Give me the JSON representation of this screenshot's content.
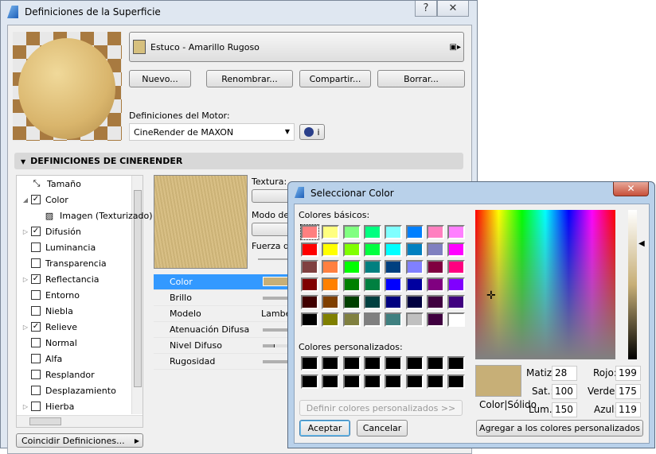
{
  "main": {
    "title": "Definiciones de la Superficie",
    "help": "?",
    "close": "✕",
    "material_name": "Estuco - Amarillo Rugoso",
    "material_color": "#d6c07e",
    "buttons": [
      "Nuevo...",
      "Renombrar...",
      "Compartir...",
      "Borrar..."
    ],
    "engine_label": "Definiciones del Motor:",
    "engine_value": "CineRender de MAXON",
    "info": "i",
    "section": "DEFINICIONES DE CINERENDER",
    "tree": [
      {
        "label": "Tamaño",
        "type": "icon"
      },
      {
        "label": "Color",
        "checked": true,
        "expanded": true
      },
      {
        "label": "Imagen (Texturizado)",
        "type": "image"
      },
      {
        "label": "Difusión",
        "checked": true,
        "expandable": true
      },
      {
        "label": "Luminancia",
        "checked": false
      },
      {
        "label": "Transparencia",
        "checked": false
      },
      {
        "label": "Reflectancia",
        "checked": true,
        "expandable": true
      },
      {
        "label": "Entorno",
        "checked": false
      },
      {
        "label": "Niebla",
        "checked": false
      },
      {
        "label": "Relieve",
        "checked": true,
        "expandable": true
      },
      {
        "label": "Normal",
        "checked": false
      },
      {
        "label": "Alfa",
        "checked": false
      },
      {
        "label": "Resplandor",
        "checked": false
      },
      {
        "label": "Desplazamiento",
        "checked": false
      },
      {
        "label": "Hierba",
        "checked": false,
        "expandable": true
      }
    ],
    "match_button": "Coincidir Definiciones...",
    "texture_label": "Textura:",
    "mode_label": "Modo de",
    "strength_label": "Fuerza d",
    "props": [
      {
        "label": "Color",
        "value": ""
      },
      {
        "label": "Brillo",
        "value": ""
      },
      {
        "label": "Modelo",
        "value": "Lambe"
      },
      {
        "label": "Atenuación Difusa",
        "value": ""
      },
      {
        "label": "Nivel Difuso",
        "value": ""
      },
      {
        "label": "Rugosidad",
        "value": ""
      }
    ]
  },
  "dialog": {
    "title": "Seleccionar Color",
    "close": "✕",
    "basic_label": "Colores básicos:",
    "basic_colors": [
      "#FF8080",
      "#FFFF80",
      "#80FF80",
      "#00FF80",
      "#80FFFF",
      "#0080FF",
      "#FF80C0",
      "#FF80FF",
      "#FF0000",
      "#FFFF00",
      "#80FF00",
      "#00FF40",
      "#00FFFF",
      "#0080C0",
      "#8080C0",
      "#FF00FF",
      "#804040",
      "#FF8040",
      "#00FF00",
      "#008080",
      "#004080",
      "#8080FF",
      "#800040",
      "#FF0080",
      "#800000",
      "#FF8000",
      "#008000",
      "#008040",
      "#0000FF",
      "#0000A0",
      "#800080",
      "#8000FF",
      "#400000",
      "#804000",
      "#004000",
      "#004040",
      "#000080",
      "#000040",
      "#400040",
      "#400080",
      "#000000",
      "#808000",
      "#808040",
      "#808080",
      "#408080",
      "#C0C0C0",
      "#400040",
      "#FFFFFF"
    ],
    "custom_label": "Colores personalizados:",
    "define_custom": "Definir colores personalizados >>",
    "ok": "Aceptar",
    "cancel": "Cancelar",
    "preview_label": "Color|Sólido",
    "current_color": "#C7AF77",
    "hue_label": "Matiz:",
    "hue": "28",
    "sat_label": "Sat.:",
    "sat": "100",
    "lum_label": "Lum.:",
    "lum": "150",
    "red_label": "Rojo:",
    "red": "199",
    "green_label": "Verde:",
    "green": "175",
    "blue_label": "Azul:",
    "blue": "119",
    "add_custom": "Agregar a los colores personalizados"
  }
}
